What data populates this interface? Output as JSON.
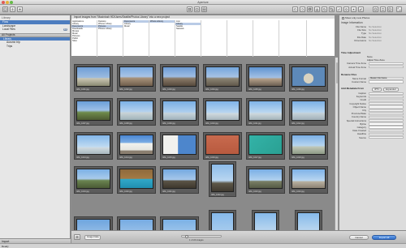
{
  "window": {
    "title": "Aperture"
  },
  "library": {
    "title": "Library",
    "items": [
      {
        "label": "Flow",
        "count": ""
      },
      {
        "label": "Landscape",
        "count": ""
      },
      {
        "label": "Local Files",
        "count": "33"
      }
    ],
    "projects_header": "All Projects",
    "projects": [
      {
        "label": "Library"
      },
      {
        "label": "Autumn trip"
      },
      {
        "label": "Trips"
      }
    ],
    "bottom_label": "Import"
  },
  "import": {
    "header": "Import images from \"Macintosh HD/Users/Seattle/Photos Library\" into a new project",
    "columns": [
      [
        "Applications",
        "Library",
        "Documents",
        "Downloads",
        "Movies",
        "Music",
        "Pictures",
        "Public",
        "Sites"
      ],
      [
        "Desktop",
        "iPhone Library",
        "Pictures",
        "Photos Library"
      ],
      [
        "Documents",
        "Library",
        "Music"
      ],
      [
        "iPhoto Library"
      ],
      [
        "Lion",
        "Library",
        "Seattle",
        "Network"
      ]
    ]
  },
  "thumbnails": [
    [
      "IMG_1001.jpg",
      "IMG_1002.jpg",
      "IMG_1003.jpg",
      "IMG_1004.jpg",
      "IMG_1005.jpg",
      "IMG_1006.jpg"
    ],
    [
      "IMG_1007.jpg",
      "IMG_1008.jpg",
      "IMG_1009.jpg",
      "IMG_1010.jpg",
      "IMG_1011.jpg",
      "IMG_1012.jpg"
    ],
    [
      "IMG_1013.jpg",
      "IMG_1014.jpg",
      "IMG_1015.jpg",
      "IMG_1016.jpg",
      "IMG_1017.jpg",
      "IMG_1018.jpg"
    ],
    [
      "IMG_1019.jpg",
      "IMG_1020.jpg",
      "IMG_1021.jpg",
      "IMG_1022.jpg",
      "IMG_1023.jpg",
      "IMG_1024.jpg"
    ]
  ],
  "right_panel": {
    "show_all_label": "Show only new Photos",
    "image_info": {
      "title": "Image Information",
      "rows": [
        {
          "k": "File Name",
          "v": "No Selection"
        },
        {
          "k": "File Size",
          "v": "No Selection"
        },
        {
          "k": "Type",
          "v": "No Selection"
        },
        {
          "k": "File Date",
          "v": "No Selection"
        },
        {
          "k": "Dimensions",
          "v": "No Selection"
        }
      ]
    },
    "time_adjustment": {
      "title": "Time Adjustment",
      "opt1": "None",
      "opt2": "Adjust Time Zone",
      "rows": [
        {
          "k": "Camera Time Zone",
          "v": ""
        },
        {
          "k": "Actual Time Zone",
          "v": ""
        }
      ]
    },
    "rename": {
      "title": "Rename Files",
      "name_format_label": "Name Format",
      "name_format_value": "Master File Name",
      "custom_name_label": "Custom Name"
    },
    "metadata": {
      "title": "Add Metadata From",
      "preset": "IPTC",
      "preset2": "Expanded",
      "rows": [
        "Caption",
        "Keywords",
        "Credit",
        "Copyright Notice",
        "Object Name",
        "City",
        "Province/State",
        "Country Name",
        "Special Instructions",
        "Byline",
        "Category",
        "Date Created",
        "Headline",
        "Source"
      ]
    },
    "cancel_label": "Cancel",
    "import_label": "Import All"
  },
  "bottom": {
    "view_mode": "Image Data",
    "count_text": "1 of 24 images"
  },
  "status": {
    "text": "Ready"
  },
  "colors": {
    "accent": "#4d7dbf",
    "selection": "#b9cbe6"
  }
}
